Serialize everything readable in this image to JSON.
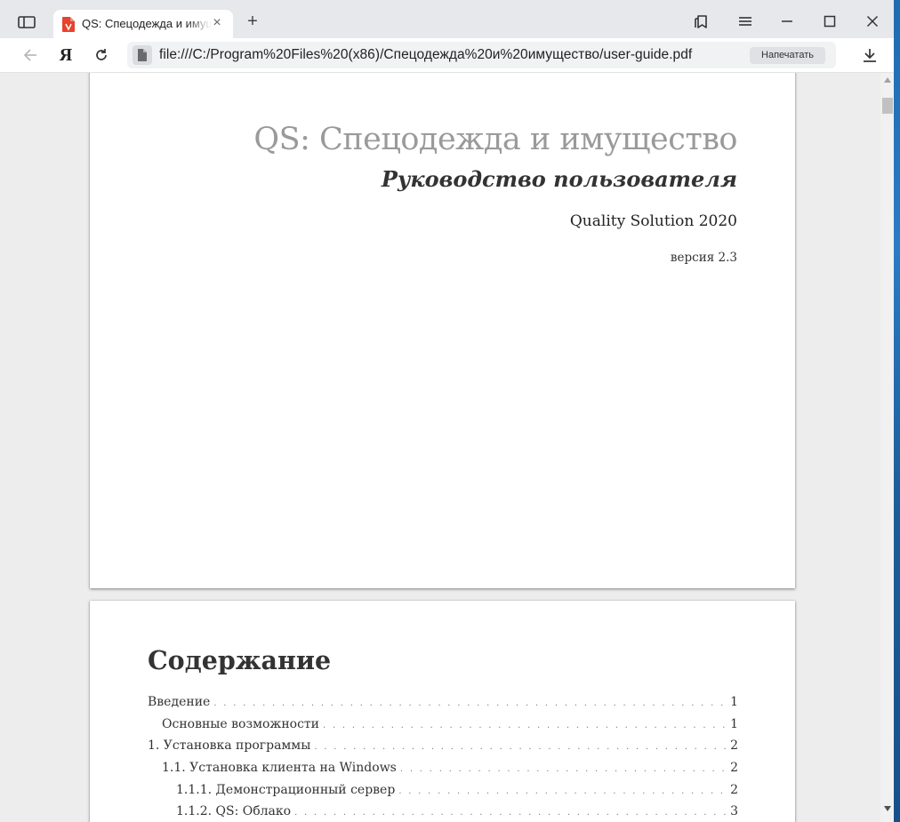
{
  "browser": {
    "tab": {
      "title": "QS: Спецодежда и имущество",
      "close_glyph": "×",
      "favicon": "pdf-file-icon",
      "favicon_color": "#e5432d"
    },
    "new_tab_glyph": "+",
    "toolbar": {
      "yandex_logo": "Я",
      "address": "file:///C:/Program%20Files%20(x86)/Спецодежда%20и%20имущество/user-guide.pdf",
      "print_label": "Напечатать"
    },
    "icons": [
      "sidebar-toggle-icon",
      "bookmarks-icon",
      "menu-icon",
      "minimize-icon",
      "maximize-icon",
      "close-icon",
      "back-arrow-icon",
      "reload-icon",
      "file-icon",
      "download-icon"
    ]
  },
  "document": {
    "title_page": {
      "title": "QS: Спецодежда и имущество",
      "subtitle": "Руководство пользователя",
      "organization": "Quality Solution 2020",
      "version": "версия 2.3"
    },
    "toc": {
      "heading": "Содержание",
      "entries": [
        {
          "label": "Введение",
          "page": "1",
          "level": 0
        },
        {
          "label": "Основные возможности",
          "page": "1",
          "level": 1
        },
        {
          "label": "1. Установка программы",
          "page": "2",
          "level": 0
        },
        {
          "label": "1.1. Установка клиента на Windows",
          "page": "2",
          "level": 1
        },
        {
          "label": "1.1.1. Демонстрационный сервер",
          "page": "2",
          "level": 2
        },
        {
          "label": "1.1.2. QS: Облако",
          "page": "3",
          "level": 2
        }
      ]
    }
  },
  "colors": {
    "chrome_bg": "#e6e8ec",
    "viewer_bg": "#ededed",
    "title_gray": "#9a9a9a",
    "text_dark": "#333333"
  }
}
